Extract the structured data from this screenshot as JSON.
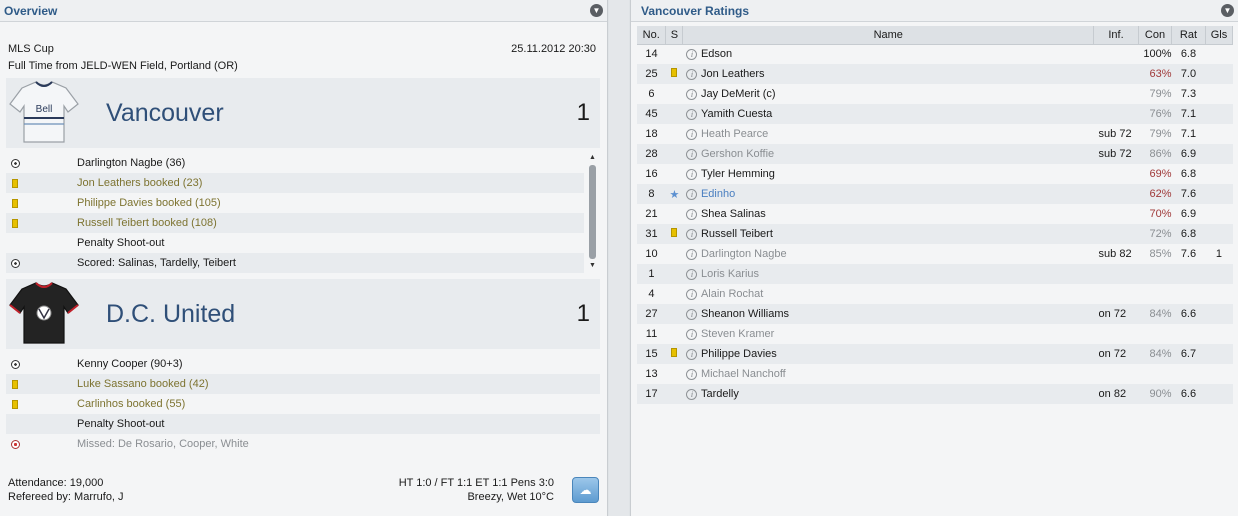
{
  "overview": {
    "title": "Overview",
    "competition": "MLS Cup",
    "datetime": "25.11.2012 20:30",
    "result_line": "Full Time from JELD-WEN Field, Portland (OR)",
    "home": {
      "name": "Vancouver",
      "score": "1",
      "kit_text": "Bell",
      "events": [
        {
          "icon": "ball",
          "text": "Darlington Nagbe (36)",
          "style": "normal"
        },
        {
          "icon": "yellow",
          "text": "Jon Leathers booked (23)",
          "style": "booked"
        },
        {
          "icon": "yellow",
          "text": "Philippe Davies booked (105)",
          "style": "booked"
        },
        {
          "icon": "yellow",
          "text": "Russell Teibert booked (108)",
          "style": "booked"
        },
        {
          "icon": "",
          "text": "Penalty Shoot-out",
          "style": "normal"
        },
        {
          "icon": "ball",
          "text": "Scored: Salinas, Tardelly, Teibert",
          "style": "normal"
        }
      ]
    },
    "away": {
      "name": "D.C. United",
      "score": "1",
      "events": [
        {
          "icon": "ball",
          "text": "Kenny Cooper (90+3)",
          "style": "normal"
        },
        {
          "icon": "yellow",
          "text": "Luke Sassano booked (42)",
          "style": "booked"
        },
        {
          "icon": "yellow",
          "text": "Carlinhos booked (55)",
          "style": "booked"
        },
        {
          "icon": "",
          "text": "Penalty Shoot-out",
          "style": "normal"
        },
        {
          "icon": "ball-red",
          "text": "Missed: De Rosario, Cooper, White",
          "style": "missed"
        }
      ]
    },
    "attendance": "Attendance: 19,000",
    "referee": "Refereed by: Marrufo, J",
    "scoreline": "HT 1:0 / FT 1:1 ET 1:1 Pens 3:0",
    "weather": "Breezy, Wet 10°C",
    "weather_icon": "rain-cloud-icon"
  },
  "ratings": {
    "title": "Vancouver Ratings",
    "columns": {
      "no": "No.",
      "s": "S",
      "name": "Name",
      "inf": "Inf.",
      "con": "Con",
      "rat": "Rat",
      "gls": "Gls"
    },
    "players": [
      {
        "no": "14",
        "s": "",
        "name": "Edson",
        "name_style": "normal",
        "inf": "",
        "con": "100%",
        "con_style": "normal",
        "rat": "6.8",
        "gls": ""
      },
      {
        "no": "25",
        "s": "yellow",
        "name": "Jon Leathers",
        "name_style": "normal",
        "inf": "",
        "con": "63%",
        "con_style": "red",
        "rat": "7.0",
        "gls": ""
      },
      {
        "no": "6",
        "s": "",
        "name": "Jay DeMerit (c)",
        "name_style": "normal",
        "inf": "",
        "con": "79%",
        "con_style": "grey",
        "rat": "7.3",
        "gls": ""
      },
      {
        "no": "45",
        "s": "",
        "name": "Yamith Cuesta",
        "name_style": "normal",
        "inf": "",
        "con": "76%",
        "con_style": "grey",
        "rat": "7.1",
        "gls": ""
      },
      {
        "no": "18",
        "s": "",
        "name": "Heath Pearce",
        "name_style": "sub",
        "inf": "sub 72",
        "con": "79%",
        "con_style": "grey",
        "rat": "7.1",
        "gls": ""
      },
      {
        "no": "28",
        "s": "",
        "name": "Gershon Koffie",
        "name_style": "sub",
        "inf": "sub 72",
        "con": "86%",
        "con_style": "grey",
        "rat": "6.9",
        "gls": ""
      },
      {
        "no": "16",
        "s": "",
        "name": "Tyler Hemming",
        "name_style": "normal",
        "inf": "",
        "con": "69%",
        "con_style": "red",
        "rat": "6.8",
        "gls": ""
      },
      {
        "no": "8",
        "s": "star",
        "name": "Edinho",
        "name_style": "star",
        "inf": "",
        "con": "62%",
        "con_style": "red",
        "rat": "7.6",
        "gls": ""
      },
      {
        "no": "21",
        "s": "",
        "name": "Shea Salinas",
        "name_style": "normal",
        "inf": "",
        "con": "70%",
        "con_style": "red",
        "rat": "6.9",
        "gls": ""
      },
      {
        "no": "31",
        "s": "yellow",
        "name": "Russell Teibert",
        "name_style": "normal",
        "inf": "",
        "con": "72%",
        "con_style": "grey",
        "rat": "6.8",
        "gls": ""
      },
      {
        "no": "10",
        "s": "",
        "name": "Darlington Nagbe",
        "name_style": "sub",
        "inf": "sub 82",
        "con": "85%",
        "con_style": "grey",
        "rat": "7.6",
        "gls": "1"
      },
      {
        "no": "1",
        "s": "",
        "name": "Loris Karius",
        "name_style": "sub",
        "inf": "",
        "con": "",
        "con_style": "grey",
        "rat": "",
        "gls": ""
      },
      {
        "no": "4",
        "s": "",
        "name": "Alain Rochat",
        "name_style": "sub",
        "inf": "",
        "con": "",
        "con_style": "grey",
        "rat": "",
        "gls": ""
      },
      {
        "no": "27",
        "s": "",
        "name": "Sheanon Williams",
        "name_style": "normal",
        "inf": "on 72",
        "con": "84%",
        "con_style": "grey",
        "rat": "6.6",
        "gls": ""
      },
      {
        "no": "11",
        "s": "",
        "name": "Steven Kramer",
        "name_style": "sub",
        "inf": "",
        "con": "",
        "con_style": "grey",
        "rat": "",
        "gls": ""
      },
      {
        "no": "15",
        "s": "yellow",
        "name": "Philippe Davies",
        "name_style": "normal",
        "inf": "on 72",
        "con": "84%",
        "con_style": "grey",
        "rat": "6.7",
        "gls": ""
      },
      {
        "no": "13",
        "s": "",
        "name": "Michael Nanchoff",
        "name_style": "sub",
        "inf": "",
        "con": "",
        "con_style": "grey",
        "rat": "",
        "gls": ""
      },
      {
        "no": "17",
        "s": "",
        "name": "Tardelly",
        "name_style": "normal",
        "inf": "on 82",
        "con": "90%",
        "con_style": "grey",
        "rat": "6.6",
        "gls": ""
      }
    ]
  }
}
